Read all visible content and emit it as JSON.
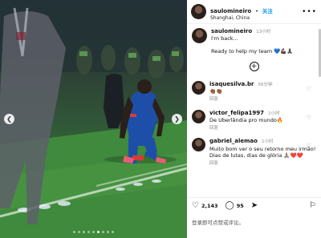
{
  "post": {
    "username": "saulomineiro",
    "follow_label": "关注",
    "location": "Shanghai, China",
    "more_icon": "more-horizontal-icon"
  },
  "caption": {
    "username": "saulomineiro",
    "time": "13小时",
    "line1": "I'm back...",
    "line2": "Ready to help my team",
    "emojis": "💙💪🏿🙏🏿"
  },
  "comments": [
    {
      "username": "isaquesilva.br",
      "time": "56分钟",
      "text": "👏🏾👏🏾",
      "reply": "回复"
    },
    {
      "username": "victor_felipa1997",
      "time": "1小时",
      "text": "De Uberlândia pro mundo🔥",
      "reply": "回复"
    },
    {
      "username": "gabriel_alemao",
      "time": "1小时",
      "text": "Muito bom ver o seu retorno meu irmão! Dias de lutas, dias de glória 🙏🏽❤️❤️",
      "reply": "回复"
    }
  ],
  "actions": {
    "likes": "2,143",
    "comments": "95"
  },
  "login_prompt": "登录即可点赞或评论。",
  "carousel": {
    "dots": 9,
    "active_index": 5,
    "prev_icon": "chevron-left-icon",
    "next_icon": "chevron-right-icon"
  },
  "colors": {
    "link_blue": "#0095f6",
    "text_grey": "#8e8e8e"
  }
}
